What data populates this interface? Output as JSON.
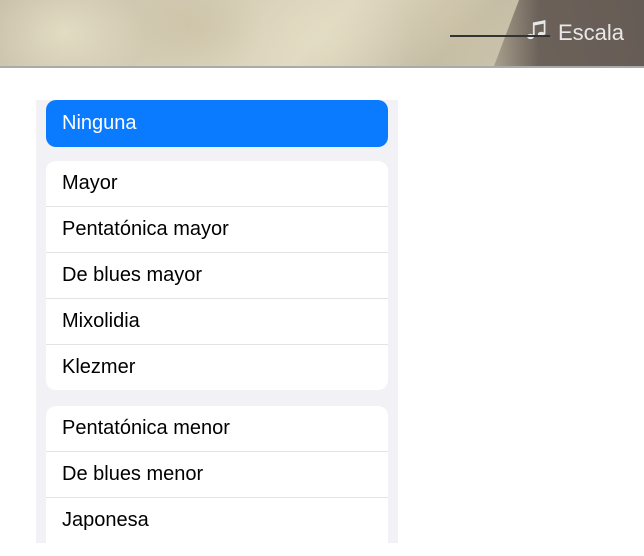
{
  "header": {
    "escala_label": "Escala"
  },
  "selected": {
    "label": "Ninguna"
  },
  "groups": [
    {
      "items": [
        {
          "label": "Mayor"
        },
        {
          "label": "Pentatónica mayor"
        },
        {
          "label": "De blues mayor"
        },
        {
          "label": "Mixolidia"
        },
        {
          "label": "Klezmer"
        }
      ]
    },
    {
      "items": [
        {
          "label": "Pentatónica menor"
        },
        {
          "label": "De blues menor"
        },
        {
          "label": "Japonesa"
        }
      ]
    }
  ]
}
